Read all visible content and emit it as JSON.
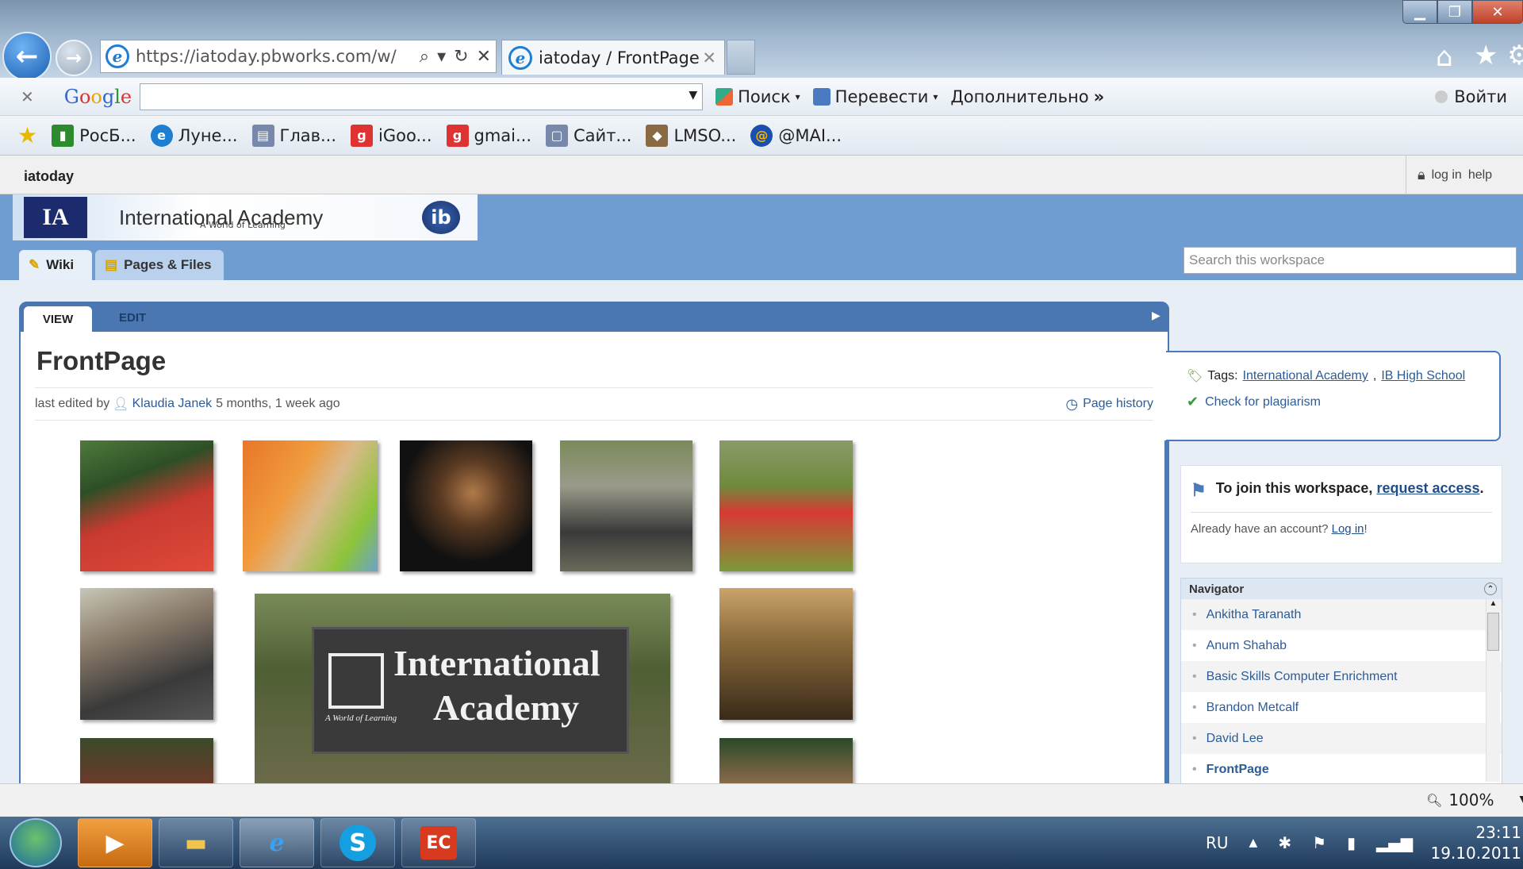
{
  "browser": {
    "url": "https://iatoday.pbworks.com/w/",
    "tab_title": "iatoday / FrontPage",
    "tab_close": "✕",
    "google_bar": {
      "logo": "Google",
      "search_value": "",
      "search_btn": "Поиск",
      "translate": "Перевести",
      "more": "Дополнительно",
      "login": "Войти",
      "close": "✕"
    },
    "bookmarks": [
      {
        "label": "РосБ...",
        "color": "#2d8a2d"
      },
      {
        "label": "Луне...",
        "color": "#1e7fd2"
      },
      {
        "label": "Глав...",
        "color": "#7788aa"
      },
      {
        "label": "iGoo...",
        "color": "#d33"
      },
      {
        "label": "gmai...",
        "color": "#d33"
      },
      {
        "label": "Сайт...",
        "color": "#7788aa"
      },
      {
        "label": "LMSO...",
        "color": "#8a6a40"
      },
      {
        "label": "@MAI...",
        "color": "#1a4fb0"
      }
    ],
    "zoom": "100%"
  },
  "site": {
    "workspace": "iatoday",
    "login": "log in",
    "help": "help",
    "banner_title": "International Academy",
    "banner_sub": "A World of Learning",
    "ia_logo": "IA",
    "ib_logo": "ib",
    "tabs": {
      "wiki": "Wiki",
      "pages": "Pages & Files"
    },
    "search_placeholder": "Search this workspace",
    "view_tab": "VIEW",
    "edit_tab": "EDIT",
    "page_title": "FrontPage",
    "meta": {
      "prefix": "last edited by",
      "author": "Klaudia Janek",
      "time": "5 months, 1 week ago",
      "history": "Page history"
    },
    "tags_label": "Tags:",
    "tags": [
      "International Academy",
      "IB High School"
    ],
    "tag_sep": ",",
    "plagiarism": "Check for plagiarism",
    "join": {
      "text": "To join this workspace,",
      "link": "request access",
      "period": ".",
      "already": "Already have an account?",
      "login_link": "Log in",
      "bang": "!"
    },
    "sign": {
      "line1": "International",
      "line2": "Academy",
      "small": "A World of Learning"
    },
    "navigator": {
      "title": "Navigator",
      "items": [
        "Ankitha Taranath",
        "Anum Shahab",
        "Basic Skills Computer Enrichment",
        "Brandon Metcalf",
        "David Lee",
        "FrontPage"
      ]
    }
  },
  "taskbar": {
    "lang": "RU",
    "time": "23:11",
    "date": "19.10.2011"
  }
}
